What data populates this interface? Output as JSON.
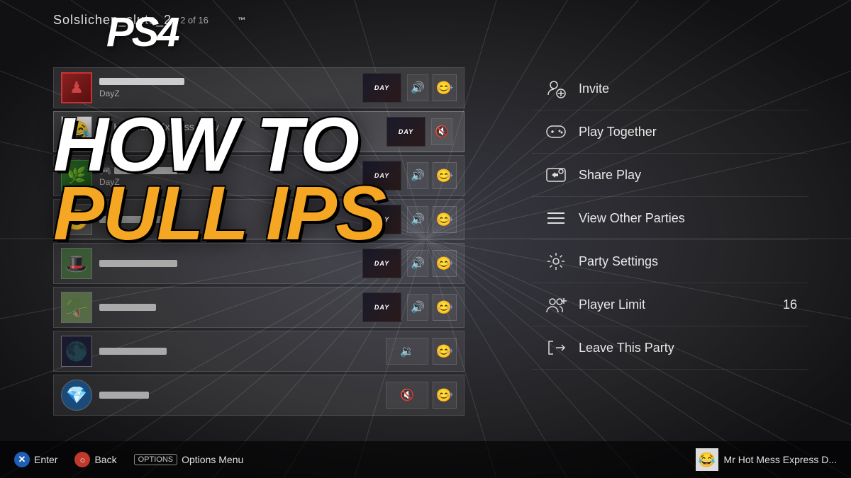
{
  "background": {
    "color": "#2a2a2e"
  },
  "header": {
    "party_name": "Solslichen_sluts_2",
    "member_count": "2 of 16",
    "ps4_logo": "PS4"
  },
  "members": [
    {
      "id": 1,
      "name": "",
      "game": "DayZ",
      "avatar": "🎮",
      "avatar_type": "red",
      "audio": "on",
      "has_friend_btn": true,
      "highlighted": false
    },
    {
      "id": 2,
      "name": "Mr Hot Mess Express Daily",
      "game": "DayZ",
      "avatar": "😂",
      "avatar_type": "troll",
      "audio": "muted",
      "has_friend_btn": false,
      "highlighted": true
    },
    {
      "id": 3,
      "name": "",
      "game": "DayZ",
      "avatar": "🌿",
      "avatar_type": "green",
      "audio": "on",
      "has_friend_btn": true,
      "highlighted": false,
      "has_controller": true
    },
    {
      "id": 4,
      "name": "",
      "game": "",
      "avatar": "😊",
      "avatar_type": "smiley",
      "audio": "on",
      "has_friend_btn": true,
      "highlighted": false
    },
    {
      "id": 5,
      "name": "",
      "game": "",
      "avatar": "🎩",
      "avatar_type": "hat",
      "audio": "on",
      "has_friend_btn": true,
      "highlighted": false
    },
    {
      "id": 6,
      "name": "",
      "game": "",
      "avatar": "🪖",
      "avatar_type": "soldier",
      "audio": "on",
      "has_friend_btn": true,
      "highlighted": false
    },
    {
      "id": 7,
      "name": "",
      "game": "",
      "avatar": "🌑",
      "avatar_type": "dark",
      "audio": "low",
      "has_friend_btn": true,
      "highlighted": false
    },
    {
      "id": 8,
      "name": "",
      "game": "",
      "avatar": "💎",
      "avatar_type": "blue",
      "audio": "off",
      "has_friend_btn": true,
      "highlighted": false
    }
  ],
  "menu": {
    "items": [
      {
        "id": "invite",
        "label": "Invite",
        "icon": "invite",
        "value": ""
      },
      {
        "id": "play-together",
        "label": "Play Together",
        "icon": "controller",
        "value": ""
      },
      {
        "id": "share-play",
        "label": "Share Play",
        "icon": "share",
        "value": ""
      },
      {
        "id": "view-other-parties",
        "label": "View Other Parties",
        "icon": "list",
        "value": ""
      },
      {
        "id": "party-settings",
        "label": "Party Settings",
        "icon": "settings",
        "value": ""
      },
      {
        "id": "player-limit",
        "label": "Player Limit",
        "icon": "players",
        "value": "16"
      },
      {
        "id": "leave-party",
        "label": "Leave This Party",
        "icon": "leave",
        "value": ""
      }
    ]
  },
  "overlay": {
    "line1": "HOW TO",
    "line2": "PULL IPS"
  },
  "bottom_bar": {
    "enter_label": "Enter",
    "back_label": "Back",
    "options_label": "OPTIONS",
    "options_menu_label": "Options Menu",
    "current_user": "Mr Hot Mess Express D..."
  }
}
